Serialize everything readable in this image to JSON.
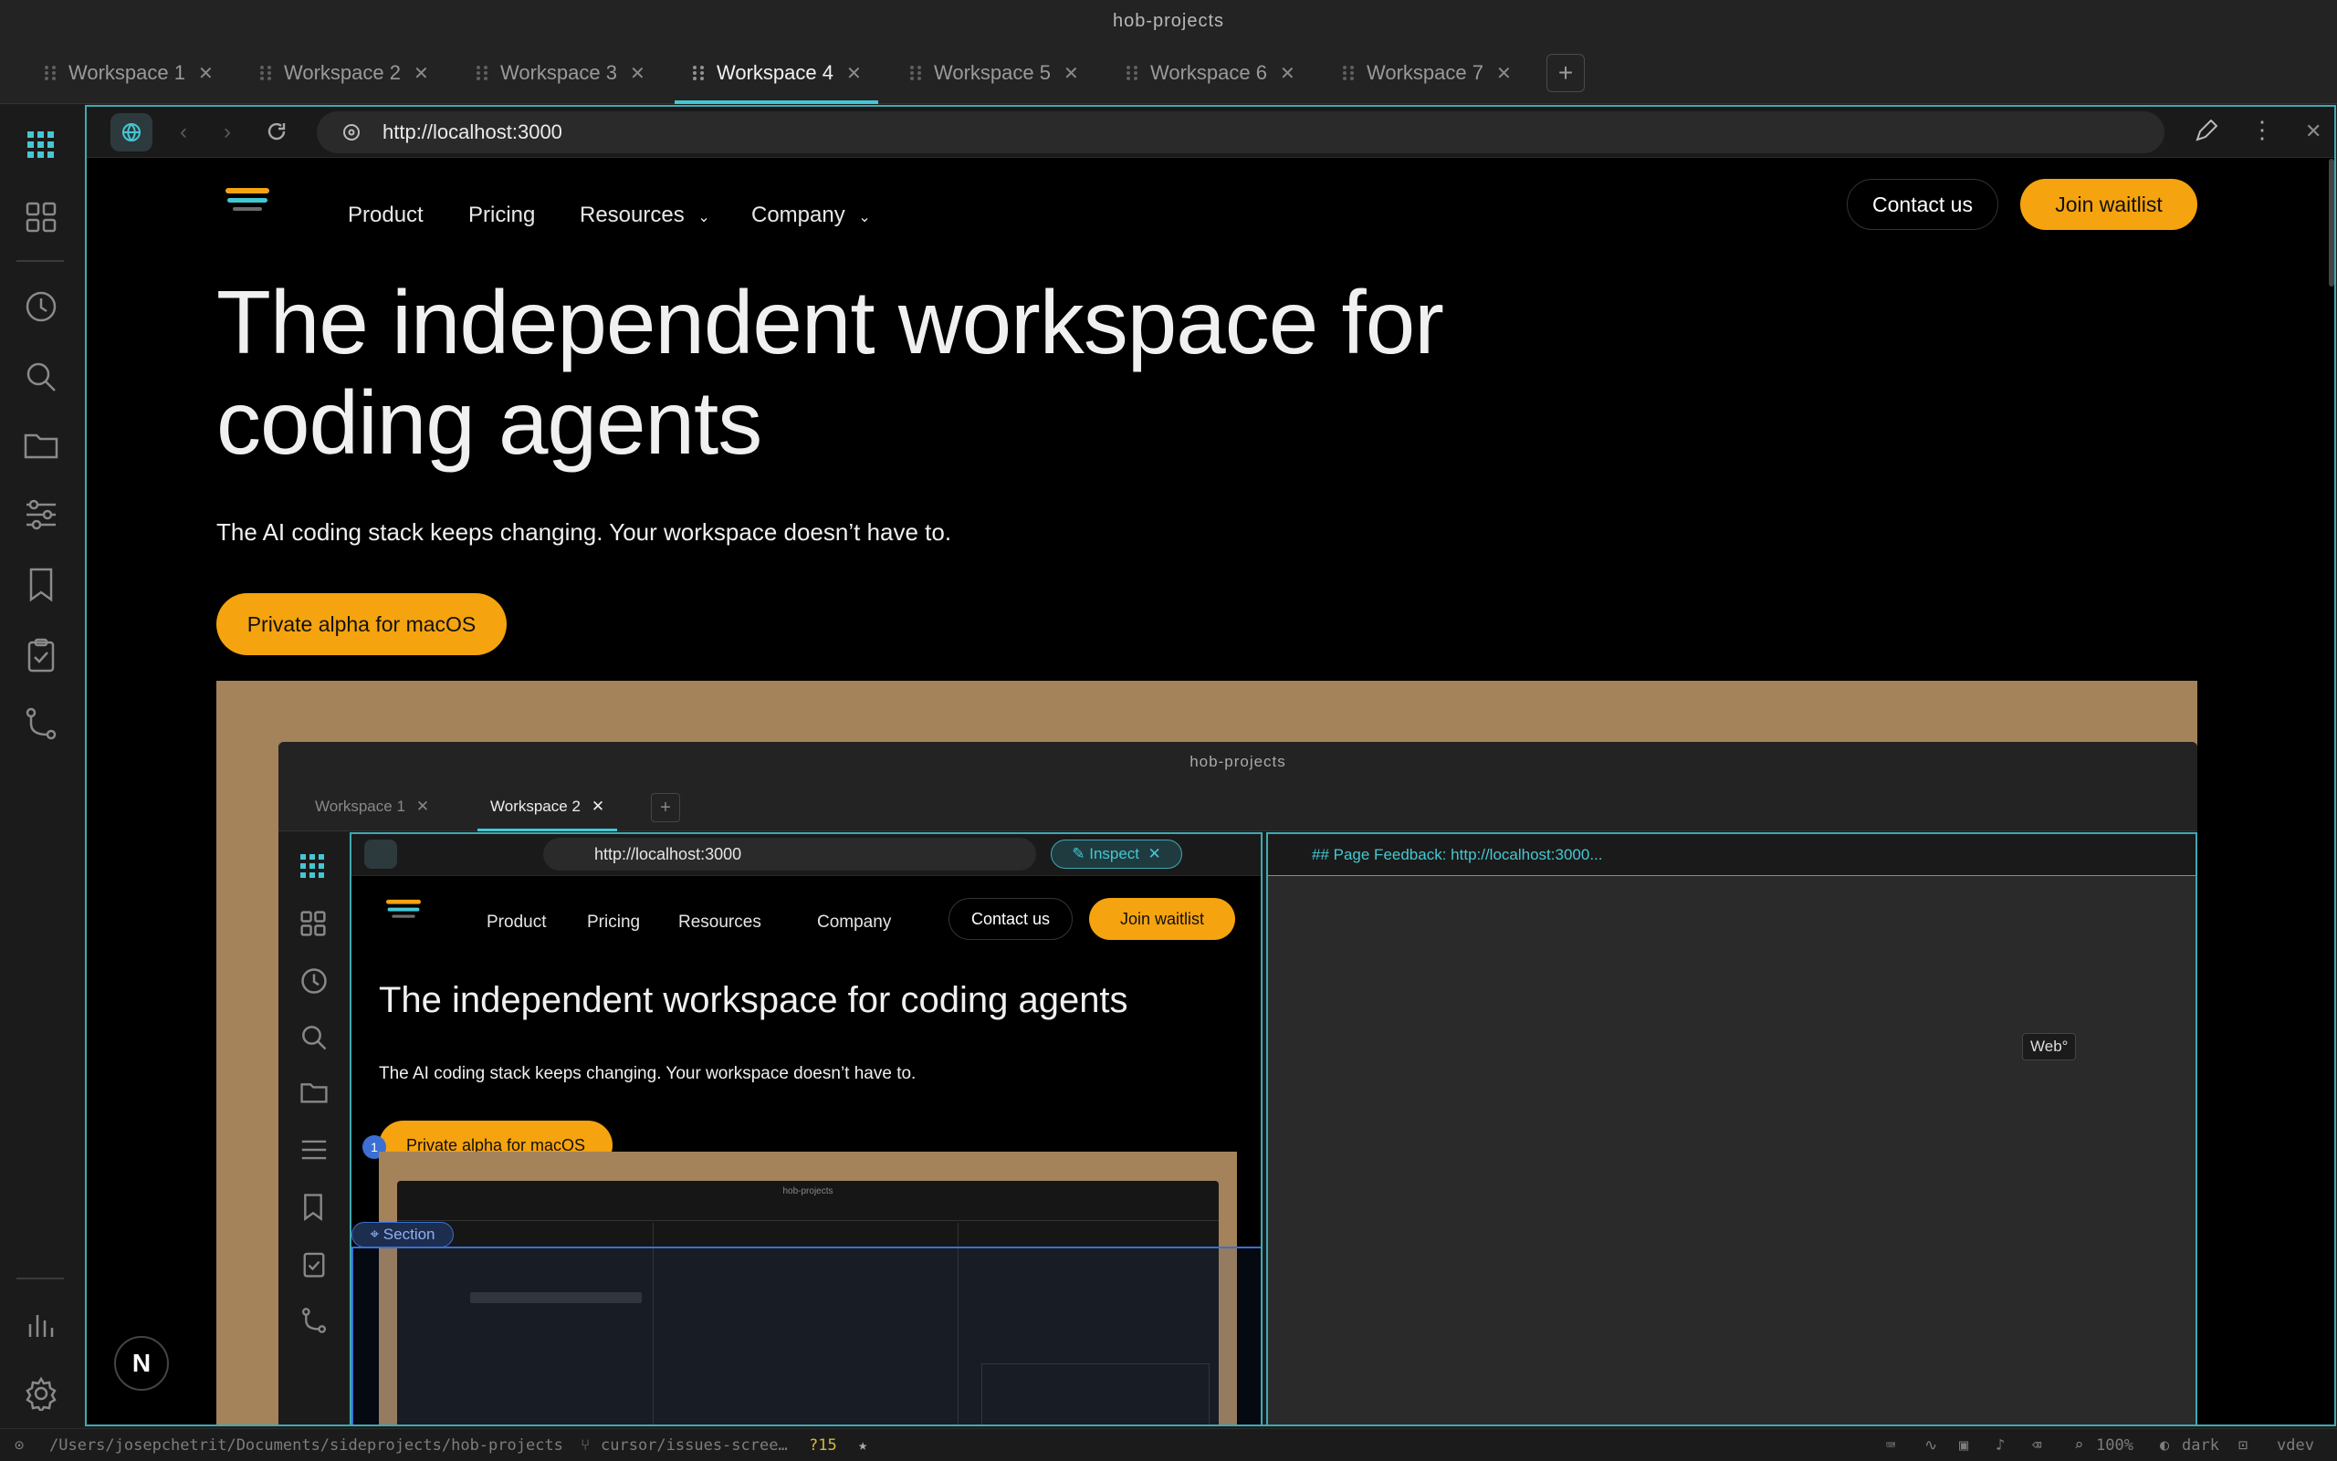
{
  "window": {
    "title": "hob-projects"
  },
  "tabs": [
    {
      "label": "Workspace 1",
      "active": false
    },
    {
      "label": "Workspace 2",
      "active": false
    },
    {
      "label": "Workspace 3",
      "active": false
    },
    {
      "label": "Workspace 4",
      "active": true
    },
    {
      "label": "Workspace 5",
      "active": false
    },
    {
      "label": "Workspace 6",
      "active": false
    },
    {
      "label": "Workspace 7",
      "active": false
    }
  ],
  "new_tab": "+",
  "browser": {
    "url": "http://localhost:3000"
  },
  "site": {
    "nav": {
      "product": "Product",
      "pricing": "Pricing",
      "resources": "Resources",
      "company": "Company"
    },
    "contact": "Contact us",
    "join": "Join waitlist",
    "hero_line1": "The independent workspace for",
    "hero_line2": "coding agents",
    "sub": "The AI coding stack keeps changing. Your workspace doesn’t have to.",
    "cta": "Private alpha for macOS"
  },
  "inner": {
    "title": "hob-projects",
    "tabs": [
      "Workspace 1",
      "Workspace 2"
    ],
    "url": "http://localhost:3000",
    "inspect": "Inspect",
    "panel_title": "## Page Feedback: http://localhost:3000...",
    "web_badge": "Web°",
    "hero": "The independent workspace for coding agents",
    "section_label": "Section",
    "marker": "1",
    "mini_title": "hob-projects"
  },
  "nextjs_badge": "N",
  "status": {
    "path": "/Users/josepchetrit/Documents/sideprojects/hob-projects",
    "branch": "cursor/issues-scree…",
    "changes": "?15",
    "star": "★",
    "zoom": "100%",
    "theme": "dark",
    "env": "vdev"
  },
  "colors": {
    "accent": "#45c7d3",
    "cta": "#f5a30f",
    "frame": "#3fa9b3"
  }
}
